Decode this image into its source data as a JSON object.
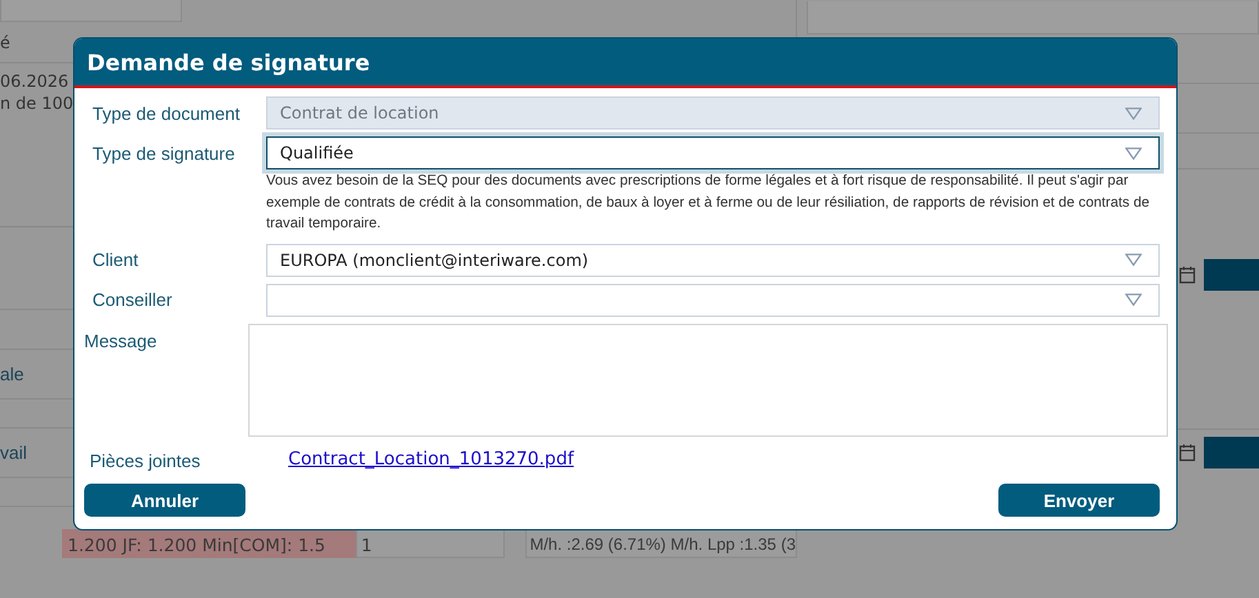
{
  "backdrop": {
    "header_text": "é",
    "date": "06.2026",
    "line_2": "n de 100",
    "label_1": "ale",
    "label_2": "vail",
    "status_cells": [
      {
        "text": "1.200 JF: 1.200 Min[COM]: 1.5",
        "kind": "alert"
      },
      {
        "text": "1",
        "kind": "plain"
      },
      {
        "text": "M/h. :2.69 (6.71%) M/h. Lpp :1.35 (3",
        "kind": "plain"
      }
    ]
  },
  "dialog": {
    "title": "Demande de signature",
    "fields": [
      {
        "label": "Type de document",
        "value": "Contrat de location",
        "disabled": true,
        "focused": false
      },
      {
        "label": "Type de signature",
        "value": "Qualifiée",
        "disabled": false,
        "focused": true,
        "hint": "Vous avez besoin de la SEQ pour des documents avec prescriptions de forme légales et à fort risque de responsabilité. Il peut s'agir par exemple de contrats de crédit à la consommation, de baux à loyer et à ferme ou de leur résiliation, de rapports de révision et de contrats de travail temporaire."
      },
      {
        "label": "Client",
        "value": "EUROPA (monclient@interiware.com)",
        "disabled": false,
        "focused": false
      },
      {
        "label": "Conseiller",
        "disabled": false,
        "focused": false
      }
    ],
    "message": {
      "label": "Message"
    },
    "attachments": {
      "label": "Pièces jointes",
      "files": [
        "Contract_Location_1013270.pdf"
      ]
    },
    "buttons": [
      {
        "label": "Annuler",
        "kind": "cancel"
      },
      {
        "label": "Envoyer",
        "kind": "submit"
      }
    ]
  }
}
